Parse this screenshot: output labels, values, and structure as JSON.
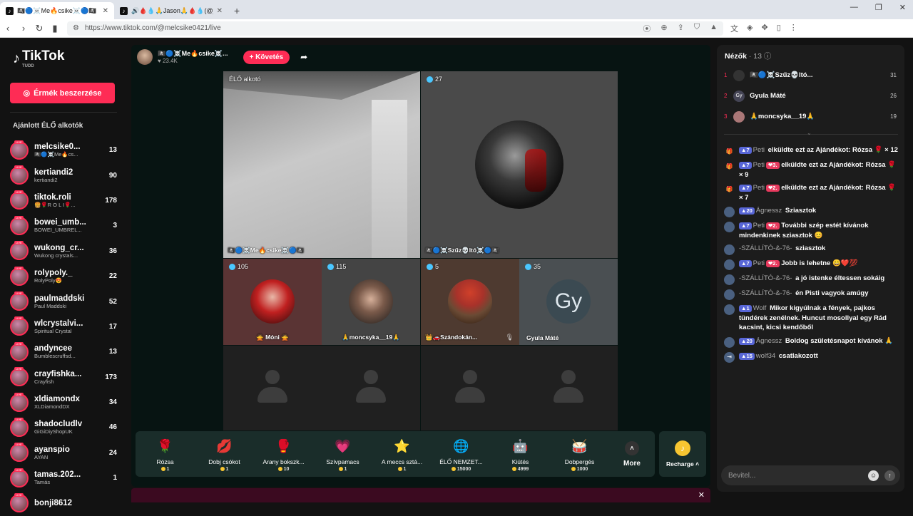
{
  "browser": {
    "tabs": [
      {
        "title": "🏴‍☠️🔵☠️Me🔥csike☠️🔵🏴‍☠️",
        "active": true
      },
      {
        "title": "🔊🩸💧🙏Jason🙏🩸💧(@jason_sem",
        "active": false
      }
    ],
    "url": "https://www.tiktok.com/@melcsike0421/live"
  },
  "sidebar": {
    "logo": "TikTok",
    "logo_sub": "TUDD",
    "coins_button": "Érmék beszerzése",
    "section_title": "Ajánlott ÉLŐ alkotók",
    "live_tag": "LIVE",
    "creators": [
      {
        "name": "melcsike0...",
        "sub": "🏴‍☠️🔵☠️Me🔥cs...",
        "count": "13"
      },
      {
        "name": "kertiandi2",
        "sub": "kertiandi2",
        "count": "90"
      },
      {
        "name": "tiktok.roli",
        "sub": "🍔🌹R O L I🌹...",
        "count": "178"
      },
      {
        "name": "bowei_umb...",
        "sub": "BOWEI_UMBREL...",
        "count": "3"
      },
      {
        "name": "wukong_cr...",
        "sub": "Wukong crystals...",
        "count": "36"
      },
      {
        "name": "rolypoly._",
        "sub": "RolyPoly😍",
        "count": "22"
      },
      {
        "name": "paulmaddski",
        "sub": "Paul Maddski",
        "count": "52"
      },
      {
        "name": "wlcrystalvi...",
        "sub": "Spiritual Crystal",
        "count": "17"
      },
      {
        "name": "andyncee",
        "sub": "Bumblescruffsd...",
        "count": "13"
      },
      {
        "name": "crayfishka...",
        "sub": "Crayfish",
        "count": "173"
      },
      {
        "name": "xldiamondx",
        "sub": "XLDiamondDX",
        "count": "34"
      },
      {
        "name": "shadocludlv",
        "sub": "GiGiDiyShopUK",
        "count": "46"
      },
      {
        "name": "ayanspio",
        "sub": "AYAN",
        "count": "24"
      },
      {
        "name": "tamas.202...",
        "sub": "Tamás",
        "count": "1"
      },
      {
        "name": "bonji8612",
        "sub": "",
        "count": ""
      }
    ]
  },
  "stream": {
    "streamer_name": "🏴‍☠️🔵☠️Me🔥csike☠️...",
    "likes": "23.4K",
    "follow_label": "+ Követés",
    "host_tag": "ÉLŐ alkotó",
    "host_name": "🏴‍☠️🔵☠️Me🔥csike☠️🔵🏴‍☠️",
    "cohost": {
      "count": "27",
      "name": "🏴‍☠️🔵☠️Szűz💀ltó☠️🔵🏴‍☠️"
    },
    "guests": [
      {
        "count": "105",
        "name": "🙅 Móni 🙅"
      },
      {
        "count": "115",
        "name": "🙏moncsyka__19🙏"
      },
      {
        "count": "5",
        "name": "👑🚗Szándokán..."
      },
      {
        "count": "35",
        "name": "Gyula Máté",
        "initials": "Gy"
      }
    ]
  },
  "gifts": [
    {
      "name": "Rózsa",
      "price": "1",
      "icon": "🌹"
    },
    {
      "name": "Dobj csókot",
      "price": "1",
      "icon": "💋"
    },
    {
      "name": "Arany bokszk...",
      "price": "10",
      "icon": "🥊"
    },
    {
      "name": "Szívpamacs",
      "price": "1",
      "icon": "💗"
    },
    {
      "name": "A meccs sztá...",
      "price": "1",
      "icon": "⭐"
    },
    {
      "name": "ÉLŐ NEMZET...",
      "price": "15000",
      "icon": "🌐"
    },
    {
      "name": "Kiütés",
      "price": "4999",
      "icon": "🤖"
    },
    {
      "name": "Dobpergés",
      "price": "1000",
      "icon": "🥁"
    }
  ],
  "more_label": "More",
  "recharge_label": "Recharge",
  "panel": {
    "viewers_label": "Nézők",
    "viewers_count": "13",
    "top_viewers": [
      {
        "rank": "1",
        "name": "🏴‍☠️🔵☠️Szűz💀ltó...",
        "score": "31"
      },
      {
        "rank": "2",
        "name": "Gyula Máté",
        "score": "26",
        "initials": "Gy"
      },
      {
        "rank": "3",
        "name": "🙏moncsyka__19🙏",
        "score": "19"
      }
    ],
    "chat": [
      {
        "type": "gift",
        "level": "7",
        "user": "Peti",
        "fan": "",
        "text": "elküldte ezt az Ajándékot: Rózsa 🌹 × 12"
      },
      {
        "type": "gift",
        "level": "7",
        "user": "Peti",
        "fan": "3.",
        "text": "elküldte ezt az Ajándékot: Rózsa 🌹 × 9"
      },
      {
        "type": "gift",
        "level": "7",
        "user": "Peti",
        "fan": "2.",
        "text": "elküldte ezt az Ajándékot: Rózsa 🌹 × 7"
      },
      {
        "type": "msg",
        "level": "20",
        "user": "Ágnessz",
        "fan": "",
        "text": "Sziasztok"
      },
      {
        "type": "msg",
        "level": "7",
        "user": "Peti",
        "fan": "2.",
        "text": "További szép estét kívánok mindenkinek sziasztok 😊"
      },
      {
        "type": "msg",
        "level": "",
        "user": "-SZÁLLÍTÓ-&-76-",
        "fan": "",
        "text": "sziasztok"
      },
      {
        "type": "msg",
        "level": "7",
        "user": "Peti",
        "fan": "2.",
        "text": "Jobb is lehetne 😄❤️💯"
      },
      {
        "type": "msg",
        "level": "",
        "user": "-SZÁLLÍTÓ-&-76-",
        "fan": "",
        "text": "a jó istenke éltessen sokáig"
      },
      {
        "type": "msg",
        "level": "",
        "user": "-SZÁLLÍTÓ-&-76-",
        "fan": "",
        "text": "én Pisti vagyok amúgy"
      },
      {
        "type": "msg",
        "level": "1",
        "user": "Wolf",
        "fan": "",
        "text": "Mikor kigyúlnak a fények, pajkos tündérek zenélnek. Huncut mosollyal egy Rád kacsint, kicsi kendőből"
      },
      {
        "type": "msg",
        "level": "20",
        "user": "Ágnessz",
        "fan": "",
        "text": "Boldog születésnapot kívánok 🙏"
      },
      {
        "type": "join",
        "level": "15",
        "user": "wolf34",
        "fan": "",
        "text": "csatlakozott"
      }
    ],
    "input_placeholder": "Bevitel..."
  }
}
